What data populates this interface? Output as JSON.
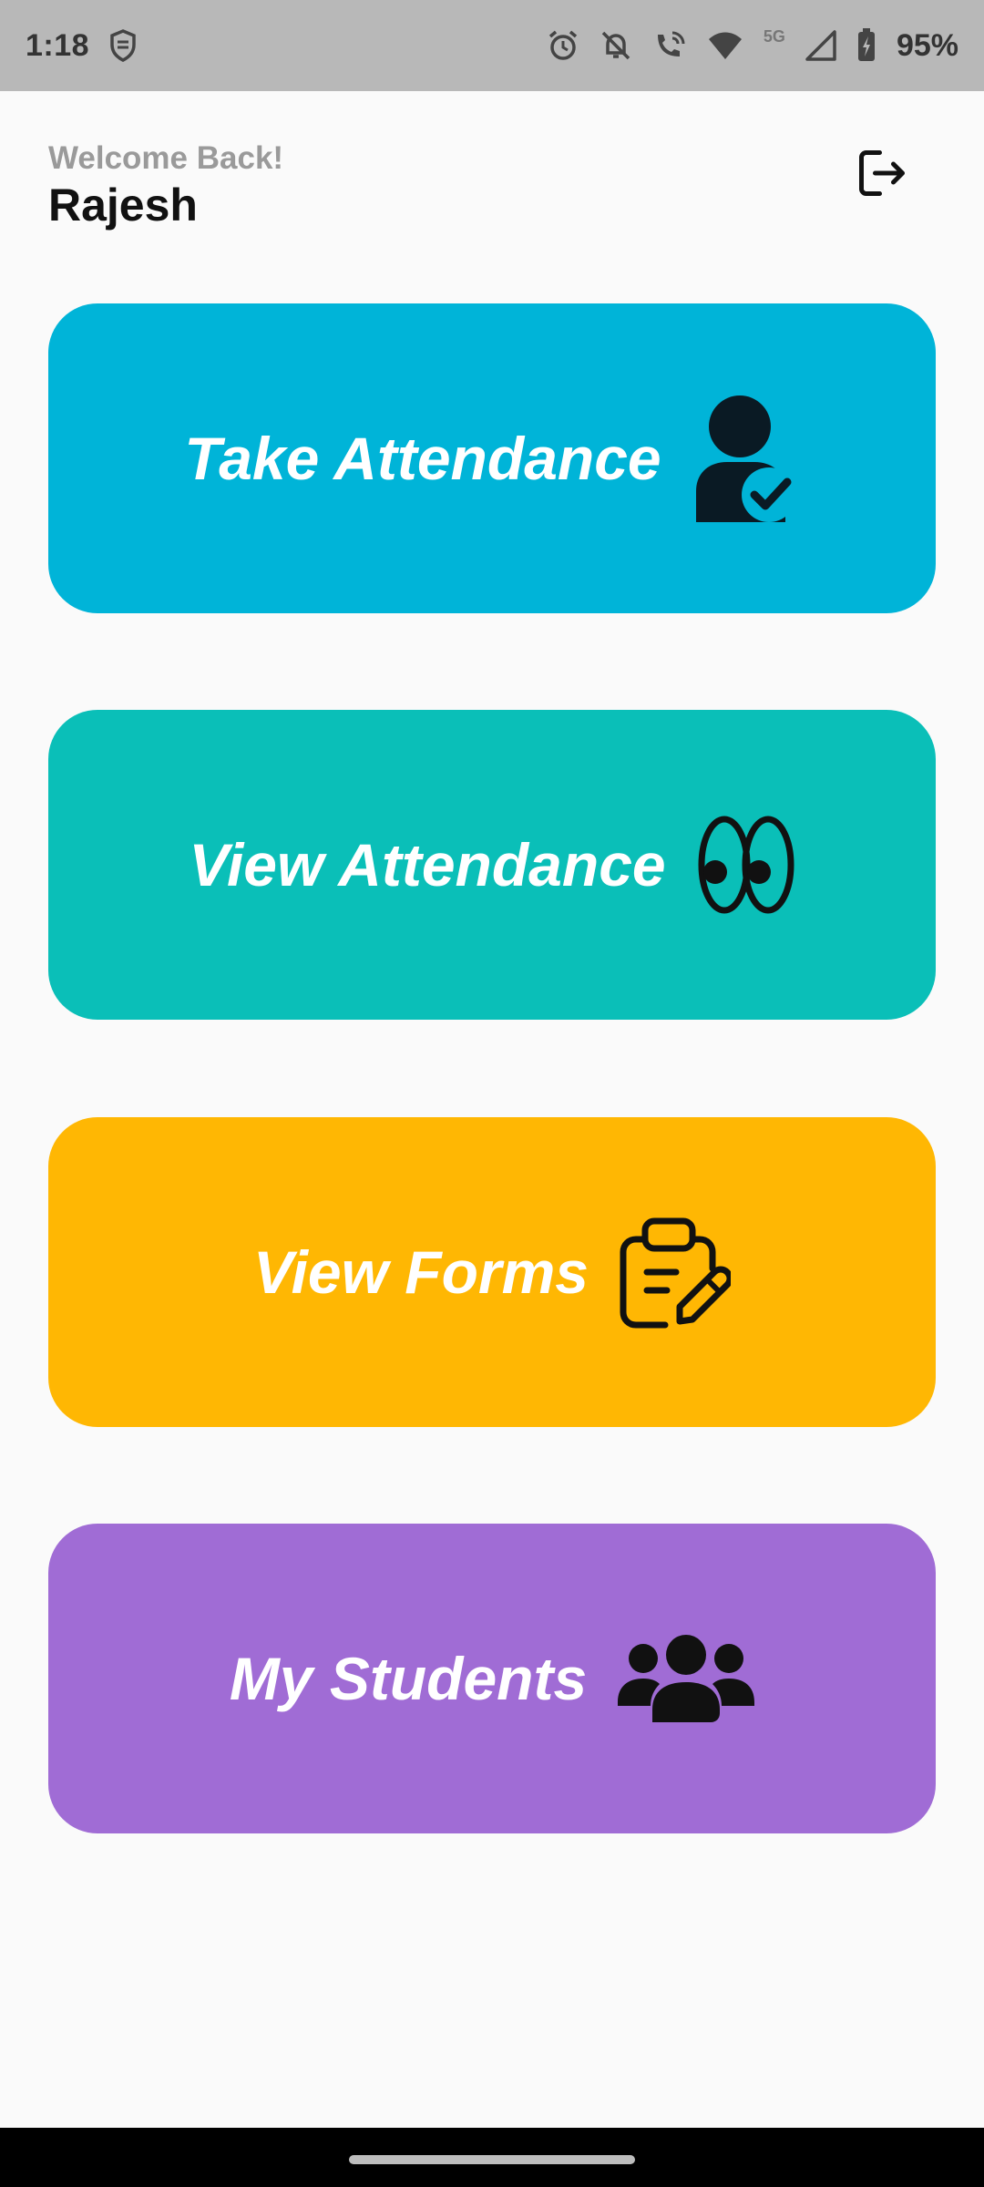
{
  "status_bar": {
    "time": "1:18",
    "network_label": "5G",
    "battery": "95%",
    "icons": [
      "shield-icon",
      "alarm-icon",
      "bell-off-icon",
      "wifi-call-icon",
      "wifi-icon",
      "signal-icon",
      "battery-charging-icon"
    ]
  },
  "header": {
    "welcome": "Welcome Back!",
    "username": "Rajesh",
    "logout_icon": "logout-icon"
  },
  "cards": [
    {
      "label": "Take Attendance",
      "icon": "user-check-icon",
      "color": "#00b4d8"
    },
    {
      "label": "View Attendance",
      "icon": "eyes-icon",
      "color": "#0abfb8"
    },
    {
      "label": "View Forms",
      "icon": "clipboard-edit-icon",
      "color": "#ffb703"
    },
    {
      "label": "My Students",
      "icon": "users-icon",
      "color": "#a06cd5"
    }
  ],
  "nav_bar": {
    "home_indicator": "home-pill"
  }
}
